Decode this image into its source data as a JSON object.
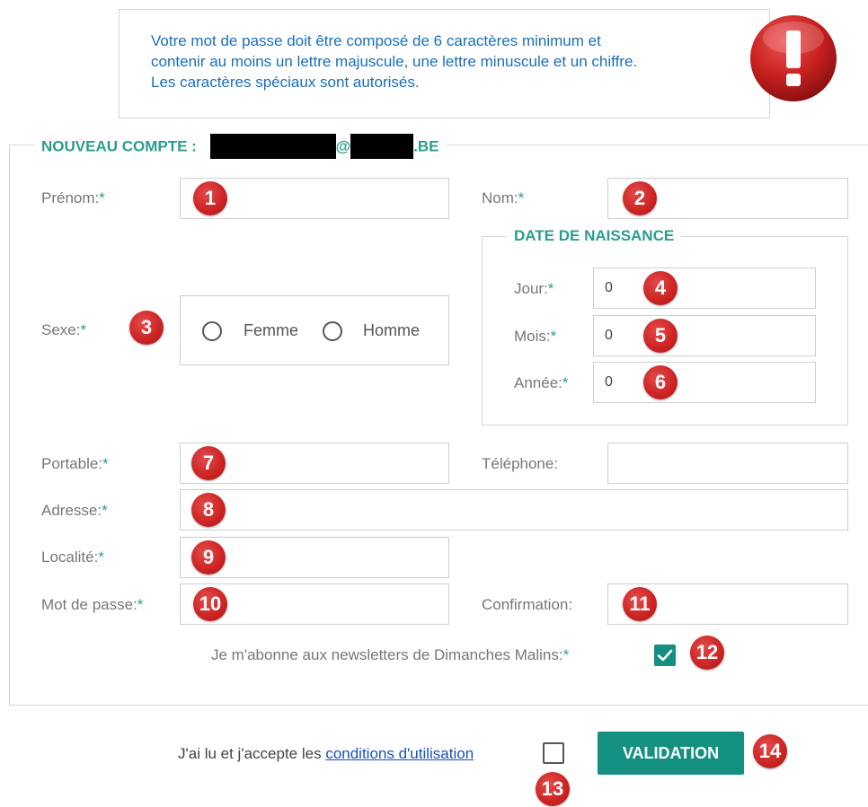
{
  "info": {
    "line1": "Votre mot de passe doit être composé de 6 caractères minimum et",
    "line2": "contenir au moins un lettre majuscule, une lettre minuscule et un chiffre.",
    "line3": "Les caractères spéciaux sont autorisés.",
    "icon": "exclamation-alert-icon"
  },
  "form": {
    "legend_prefix": "NOUVEAU COMPTE :",
    "email_at": "@",
    "email_domain_suffix": ".BE",
    "required_mark": "*",
    "firstname_label": "Prénom:",
    "lastname_label": "Nom:",
    "sex_label": "Sexe:",
    "sex_options": [
      "Femme",
      "Homme"
    ],
    "dob_legend": "DATE DE NAISSANCE",
    "day_label": "Jour:",
    "month_label": "Mois:",
    "year_label": "Année:",
    "day_value": "0",
    "month_value": "0",
    "year_value": "0",
    "mobile_label": "Portable:",
    "phone_label": "Téléphone:",
    "address_label": "Adresse:",
    "city_label": "Localité:",
    "password_label": "Mot de passe:",
    "confirm_label": "Confirmation:",
    "newsletter_label": "Je m'abonne aux newsletters de Dimanches Malins:",
    "newsletter_checked": true
  },
  "footer": {
    "terms_prefix": "J'ai lu et j'accepte les",
    "terms_link": "conditions d'utilisation",
    "terms_checked": false,
    "submit_label": "VALIDATION"
  },
  "badges": [
    "1",
    "2",
    "3",
    "4",
    "5",
    "6",
    "7",
    "8",
    "9",
    "10",
    "11",
    "12",
    "13",
    "14"
  ],
  "colors": {
    "accent": "#13907f",
    "legend": "#2a9d8f",
    "info_text": "#1a6fb8",
    "badge": "#cc2222"
  }
}
